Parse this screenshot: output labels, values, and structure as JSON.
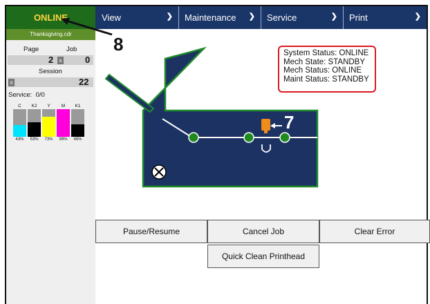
{
  "header": {
    "status": "ONLINE",
    "menus": [
      {
        "label": "View"
      },
      {
        "label": "Maintenance"
      },
      {
        "label": "Service"
      },
      {
        "label": "Print"
      }
    ]
  },
  "sidebar": {
    "filename": "Thanksgiving.cdr",
    "page_label": "Page",
    "job_label": "Job",
    "page_value": "2",
    "job_value": "0",
    "session_label": "Session",
    "session_value": "22",
    "reset_glyph": "x",
    "service_label": "Service:",
    "service_value": "0/0",
    "inks": [
      {
        "name": "C",
        "percent": "43%",
        "level": 0.43,
        "color": "#00e5ff"
      },
      {
        "name": "K2",
        "percent": "53%",
        "level": 0.53,
        "color": "#000000"
      },
      {
        "name": "Y",
        "percent": "73%",
        "level": 0.73,
        "color": "#ffff00"
      },
      {
        "name": "M",
        "percent": "99%",
        "level": 0.99,
        "color": "#ff00dd"
      },
      {
        "name": "K1",
        "percent": "46%",
        "level": 0.46,
        "color": "#000000"
      }
    ]
  },
  "status_panel": {
    "lines": [
      "System Status: ONLINE",
      "Mech State: STANDBY",
      "Mech Status: ONLINE",
      "Maint Status: STANDBY"
    ]
  },
  "annotations": {
    "callout_8": "8",
    "callout_7": "7"
  },
  "buttons": {
    "pause_resume": "Pause/Resume",
    "cancel_job": "Cancel Job",
    "clear_error": "Clear Error",
    "quick_clean": "Quick Clean Printhead"
  },
  "colors": {
    "printer_body": "#1c3263",
    "printer_outline": "#1f8a2a",
    "roller": "#1f8a1f",
    "printhead": "#f08c1a",
    "menu_bar": "#1a3568",
    "status_bg": "#1e6b1c",
    "status_text": "#ffd43b"
  },
  "icons": {
    "stop": "close-circle-icon",
    "chevron": "chevron-down-icon"
  }
}
